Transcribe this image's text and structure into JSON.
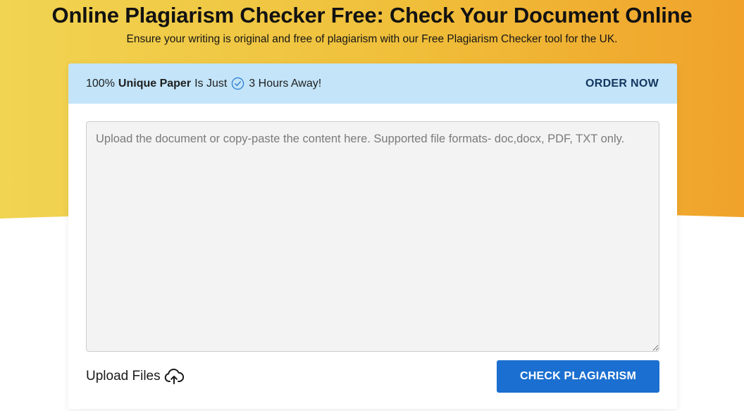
{
  "hero": {
    "title": "Online Plagiarism Checker Free: Check Your Document Online",
    "subtitle": "Ensure your writing is original and free of plagiarism with our Free Plagiarism Checker tool for the UK."
  },
  "banner": {
    "prefix": "100%",
    "bold": "Unique Paper",
    "middle": "Is Just",
    "icon": "check-circle-icon",
    "suffix": "3 Hours Away!",
    "order_label": "ORDER NOW"
  },
  "editor": {
    "value": "",
    "placeholder": "Upload the document or copy-paste the content here. Supported file formats- doc,docx, PDF, TXT only."
  },
  "actions": {
    "upload_label": "Upload Files",
    "upload_icon": "cloud-upload-icon",
    "check_label": "CHECK PLAGIARISM"
  },
  "colors": {
    "hero_gradient_start": "#f1d34f",
    "hero_gradient_end": "#f0a42a",
    "banner_bg": "#c3e4f9",
    "order_text": "#13365f",
    "primary_button": "#1b6fd0"
  }
}
